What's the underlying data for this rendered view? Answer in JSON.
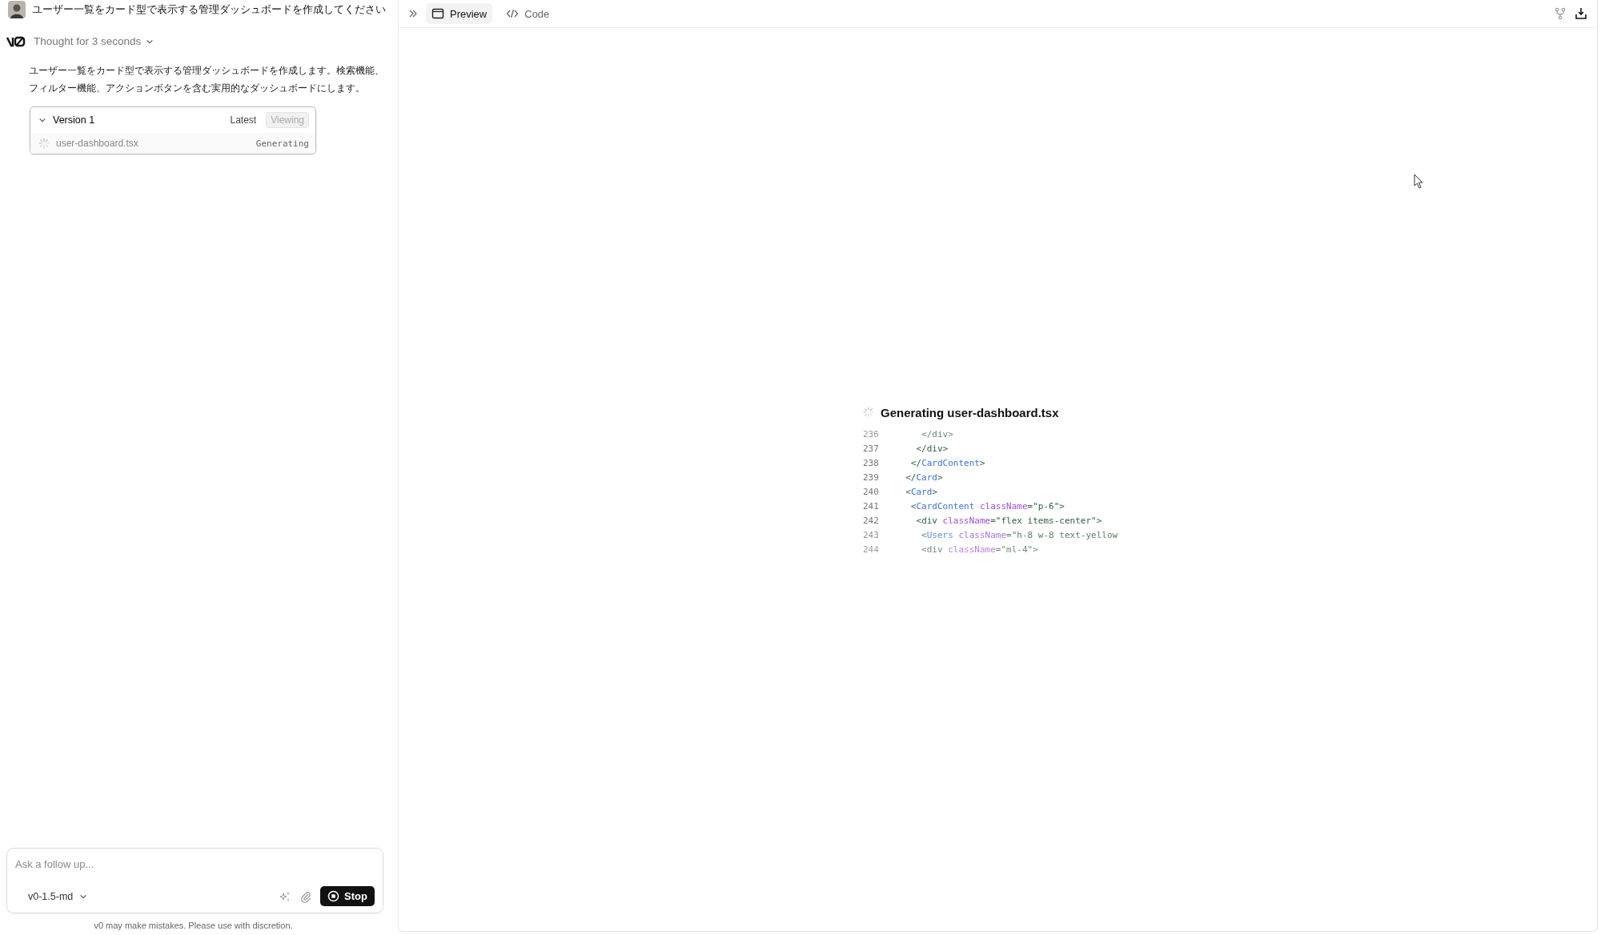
{
  "chat": {
    "user_message": "ユーザー一覧をカード型で表示する管理ダッシュボードを作成してください",
    "thought": {
      "label": "Thought for 3 seconds",
      "expanded": false
    },
    "reply": "ユーザー一覧をカード型で表示する管理ダッシュボードを作成します。検索機能、フィルター機能、アクションボタンを含む実用的なダッシュボードにします。",
    "version_card": {
      "title": "Version 1",
      "expanded": true,
      "latest": "Latest",
      "viewing": "Viewing",
      "files": [
        {
          "name": "user-dashboard.tsx",
          "status": "Generating"
        }
      ]
    },
    "input": {
      "placeholder": "Ask a follow up...",
      "model": "v0-1.5-md",
      "stop_button": "Stop"
    },
    "disclaimer": "v0 may make mistakes. Please use with discretion."
  },
  "preview": {
    "tabs": [
      {
        "label": "Preview",
        "kind": "preview",
        "selected": true
      },
      {
        "label": "Code",
        "kind": "code",
        "selected": false
      }
    ],
    "generating_title": "Generating user-dashboard.tsx",
    "code_lines": [
      {
        "number": "236",
        "tokens": [
          {
            "kind": "punct",
            "text": "     </"
          },
          {
            "kind": "tag",
            "text": "div"
          },
          {
            "kind": "punct",
            "text": ">"
          }
        ]
      },
      {
        "number": "237",
        "tokens": [
          {
            "kind": "punct",
            "text": "    </"
          },
          {
            "kind": "tag",
            "text": "div"
          },
          {
            "kind": "punct",
            "text": ">"
          }
        ]
      },
      {
        "number": "238",
        "tokens": [
          {
            "kind": "punct",
            "text": "   </"
          },
          {
            "kind": "component",
            "text": "CardContent"
          },
          {
            "kind": "punct",
            "text": ">"
          }
        ]
      },
      {
        "number": "239",
        "tokens": [
          {
            "kind": "punct",
            "text": "  </"
          },
          {
            "kind": "component",
            "text": "Card"
          },
          {
            "kind": "punct",
            "text": ">"
          }
        ]
      },
      {
        "number": "240",
        "tokens": [
          {
            "kind": "punct",
            "text": "  <"
          },
          {
            "kind": "component",
            "text": "Card"
          },
          {
            "kind": "punct",
            "text": ">"
          }
        ]
      },
      {
        "number": "241",
        "tokens": [
          {
            "kind": "punct",
            "text": "   <"
          },
          {
            "kind": "component",
            "text": "CardContent"
          },
          {
            "kind": "attr",
            "text": " className"
          },
          {
            "kind": "punct",
            "text": "="
          },
          {
            "kind": "string",
            "text": "\"p-6\""
          },
          {
            "kind": "punct",
            "text": ">"
          }
        ]
      },
      {
        "number": "242",
        "tokens": [
          {
            "kind": "punct",
            "text": "    <"
          },
          {
            "kind": "tag",
            "text": "div"
          },
          {
            "kind": "attr",
            "text": " className"
          },
          {
            "kind": "punct",
            "text": "="
          },
          {
            "kind": "string",
            "text": "\"flex items-center\""
          },
          {
            "kind": "punct",
            "text": ">"
          }
        ]
      },
      {
        "number": "243",
        "tokens": [
          {
            "kind": "punct",
            "text": "     <"
          },
          {
            "kind": "component",
            "text": "Users"
          },
          {
            "kind": "attr",
            "text": " className"
          },
          {
            "kind": "punct",
            "text": "="
          },
          {
            "kind": "string",
            "text": "\"h-8 w-8 text-yellow"
          }
        ]
      },
      {
        "number": "244",
        "tokens": [
          {
            "kind": "punct",
            "text": "     <"
          },
          {
            "kind": "tag",
            "text": "div"
          },
          {
            "kind": "attr",
            "text": " className"
          },
          {
            "kind": "punct",
            "text": "="
          },
          {
            "kind": "string",
            "text": "\"ml-4\""
          },
          {
            "kind": "punct",
            "text": ">"
          }
        ]
      }
    ]
  }
}
